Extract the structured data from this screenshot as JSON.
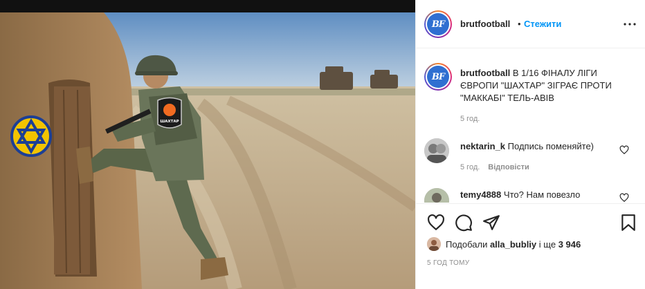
{
  "post": {
    "image_alt": "Photo of a soldier in camouflage with a Shakhtar badge kicking a door",
    "patch_text": "ШАХТАР"
  },
  "header": {
    "username": "brutfootball",
    "separator": "•",
    "follow_label": "Стежити",
    "more_label": "•••",
    "avatar_text": "BF"
  },
  "caption": {
    "username": "brutfootball",
    "text": "В 1/16 ФІНАЛУ ЛІГИ ЄВРОПИ \"ШАХТАР\" ЗІГРАЄ ПРОТИ \"МАККАБІ\" ТЕЛЬ-АВІВ",
    "time": "5 год."
  },
  "comments": [
    {
      "username": "nektarin_k",
      "text": "Подпись поменяйте)",
      "time": "5 год.",
      "reply_label": "Відповісти"
    },
    {
      "username": "temy4888",
      "text": "Что? Нам повезло"
    }
  ],
  "actions": {
    "liked_by_prefix": "Подобали",
    "liked_by_user": "alla_bubliy",
    "liked_by_middle": "і ще",
    "likes_count": "3 946",
    "post_time": "5 ГОД ТОМУ"
  },
  "colors": {
    "link_blue": "#0095f6",
    "meta_gray": "#8e8e8e",
    "text": "#262626"
  }
}
